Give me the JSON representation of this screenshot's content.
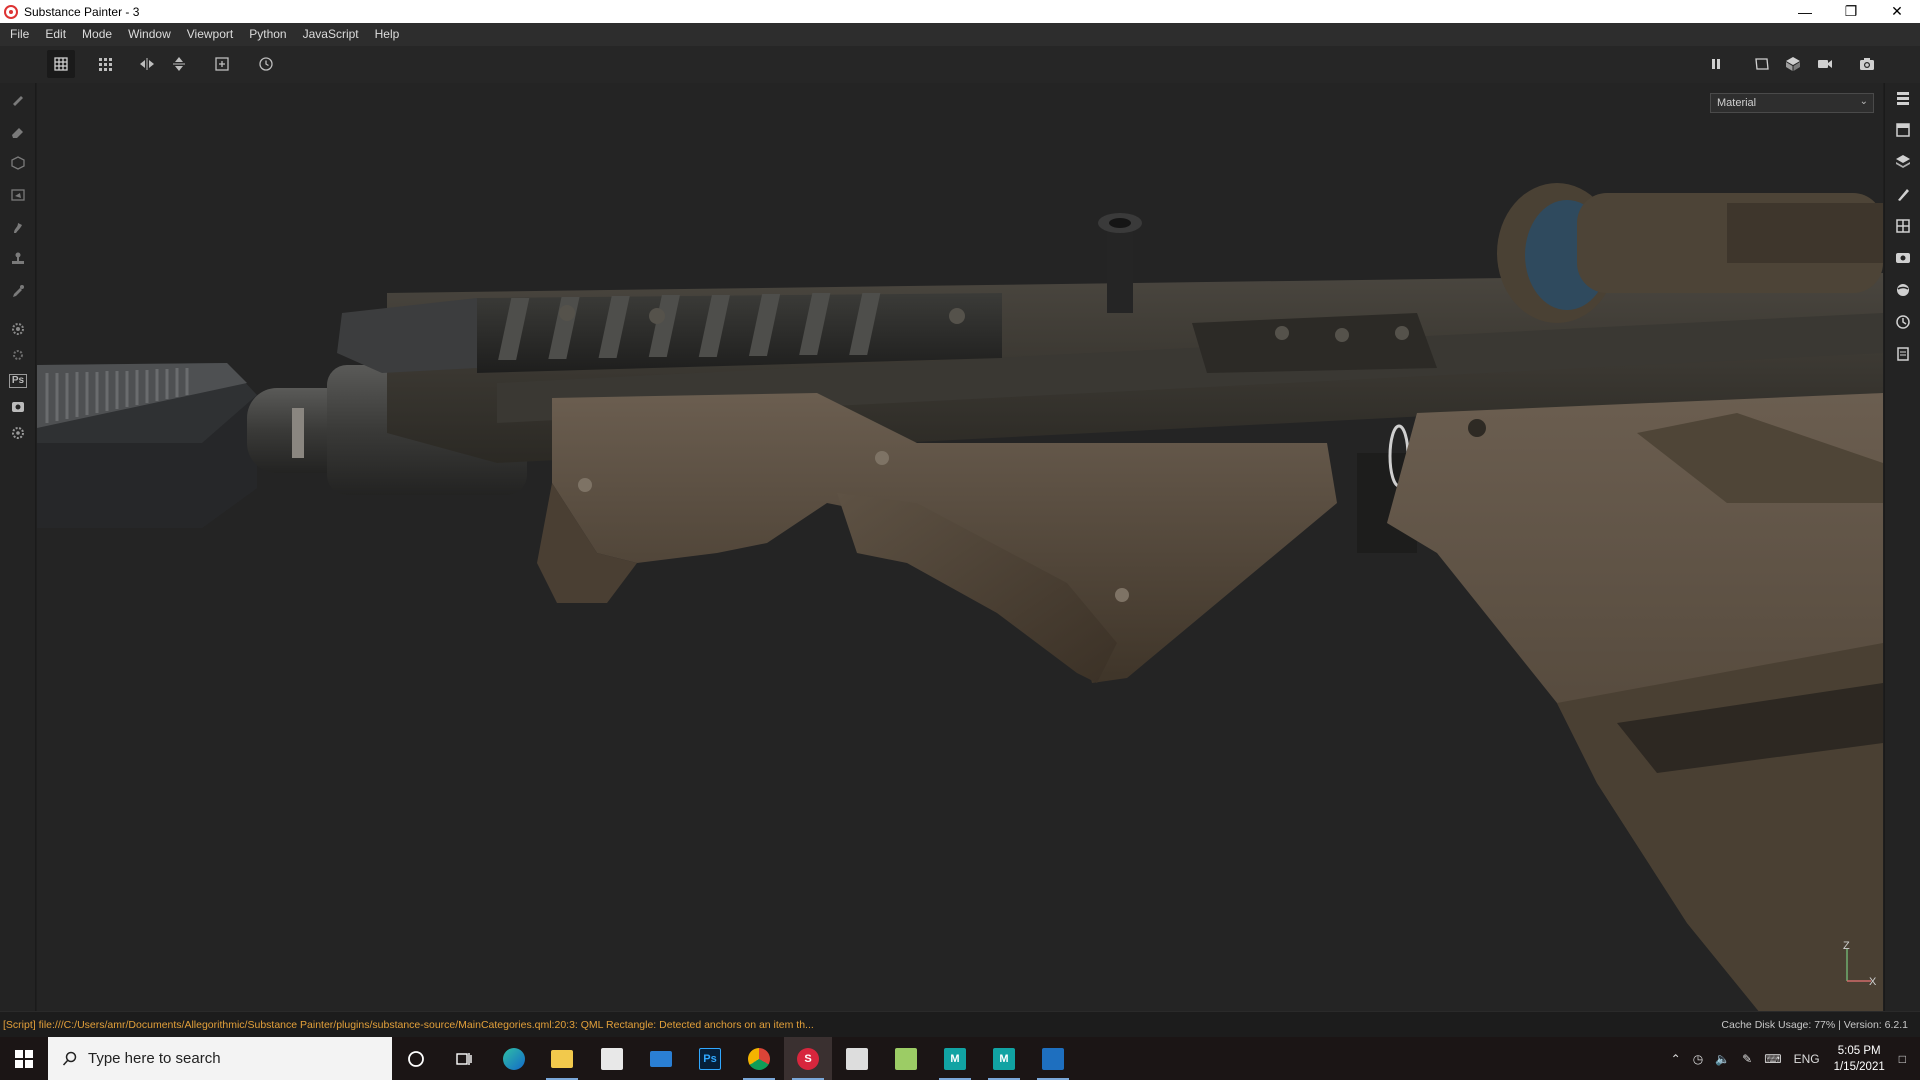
{
  "window": {
    "title": "Substance Painter - 3",
    "controls": [
      "—",
      "❐",
      "✕"
    ]
  },
  "menu": [
    "File",
    "Edit",
    "Mode",
    "Window",
    "Viewport",
    "Python",
    "JavaScript",
    "Help"
  ],
  "viewport": {
    "display_mode": "Material",
    "gizmo_axes": [
      "Z",
      "X"
    ]
  },
  "status": {
    "message": "[Script] file:///C:/Users/amr/Documents/Allegorithmic/Substance Painter/plugins/substance-source/MainCategories.qml:20:3: QML Rectangle: Detected anchors on an item th...",
    "right": "Cache Disk Usage:  77% | Version: 6.2.1"
  },
  "taskbar": {
    "search_placeholder": "Type here to search",
    "language": "ENG",
    "time": "5:05 PM",
    "date": "1/15/2021",
    "apps": [
      {
        "name": "cortana",
        "label": ""
      },
      {
        "name": "task-view",
        "label": ""
      },
      {
        "name": "edge",
        "label": ""
      },
      {
        "name": "file-explorer",
        "label": ""
      },
      {
        "name": "store",
        "label": ""
      },
      {
        "name": "mail",
        "label": ""
      },
      {
        "name": "photoshop",
        "label": "Ps"
      },
      {
        "name": "chrome",
        "label": ""
      },
      {
        "name": "substance-painter",
        "label": "S"
      },
      {
        "name": "zbrush",
        "label": ""
      },
      {
        "name": "paint",
        "label": ""
      },
      {
        "name": "maya-1",
        "label": "M"
      },
      {
        "name": "maya-2",
        "label": "M"
      },
      {
        "name": "photos",
        "label": ""
      }
    ]
  },
  "colors": {
    "status_warning": "#e3a03a",
    "viewport_bg": "#242424",
    "model_tan": "#5a4d3f",
    "model_dark": "#2f2f2c"
  }
}
